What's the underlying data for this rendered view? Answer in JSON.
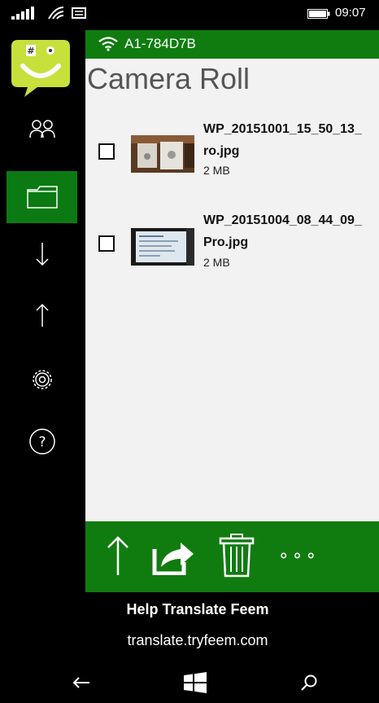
{
  "status_bar": {
    "time": "09:07",
    "icons": [
      "signal-icon",
      "wifi-calling-icon",
      "message-icon",
      "battery-icon"
    ]
  },
  "app": {
    "logo_icon": "feem-logo-icon",
    "wifi_network": "A1-784D7B",
    "page_title": "Camera Roll",
    "sidebar": [
      {
        "icon": "people-icon",
        "active": false
      },
      {
        "icon": "folder-icon",
        "active": true
      },
      {
        "icon": "download-arrow-icon",
        "active": false
      },
      {
        "icon": "upload-arrow-icon",
        "active": false
      },
      {
        "icon": "gear-icon",
        "active": false
      },
      {
        "icon": "help-icon",
        "active": false
      }
    ],
    "files": [
      {
        "name_line1": "WP_20151001_15_50_13_",
        "name_line2": "ro.jpg",
        "size": "2 MB",
        "checked": false
      },
      {
        "name_line1": "WP_20151004_08_44_09_",
        "name_line2": "Pro.jpg",
        "size": "2 MB",
        "checked": false
      }
    ],
    "actions": [
      "upload-icon",
      "share-icon",
      "trash-icon",
      "more-icon"
    ],
    "more_label": "∘∘∘"
  },
  "banner": {
    "title": "Help Translate Feem",
    "url": "translate.tryfeem.com"
  },
  "navbar": {
    "icons": [
      "back-icon",
      "windows-icon",
      "search-icon"
    ]
  },
  "colors": {
    "accent_green": "#107c10",
    "content_bg": "#f2f2f2",
    "logo_yellow": "#c7e03c"
  }
}
